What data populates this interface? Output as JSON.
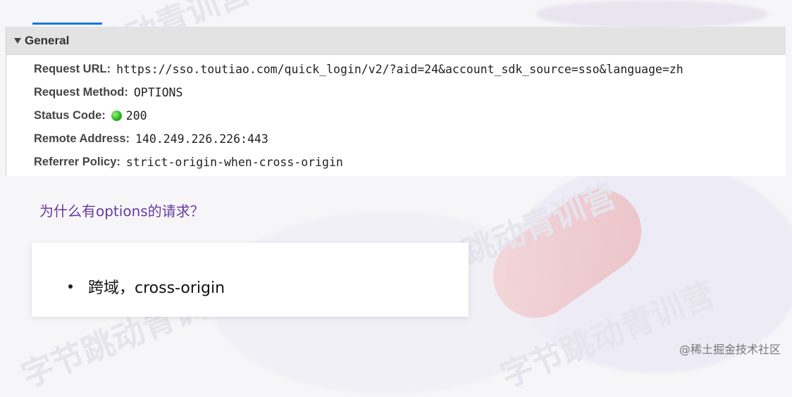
{
  "panel": {
    "section_title": "General",
    "rows": [
      {
        "key": "Request URL:",
        "value": "https://sso.toutiao.com/quick_login/v2/?aid=24&account_sdk_source=sso&language=zh"
      },
      {
        "key": "Request Method:",
        "value": "OPTIONS"
      },
      {
        "key": "Status Code:",
        "value": "200",
        "status_color": "#22b31a"
      },
      {
        "key": "Remote Address:",
        "value": "140.249.226.226:443"
      },
      {
        "key": "Referrer Policy:",
        "value": "strict-origin-when-cross-origin"
      }
    ]
  },
  "slide": {
    "question": "为什么有options的请求？",
    "bullet": "跨域，cross-origin"
  },
  "watermark": {
    "text": "字节跳动青训营",
    "footer": "@稀土掘金技术社区"
  },
  "colors": {
    "tab_accent": "#1a73e8",
    "question": "#6a3aa0",
    "header_bg": "#e3e3e3"
  }
}
